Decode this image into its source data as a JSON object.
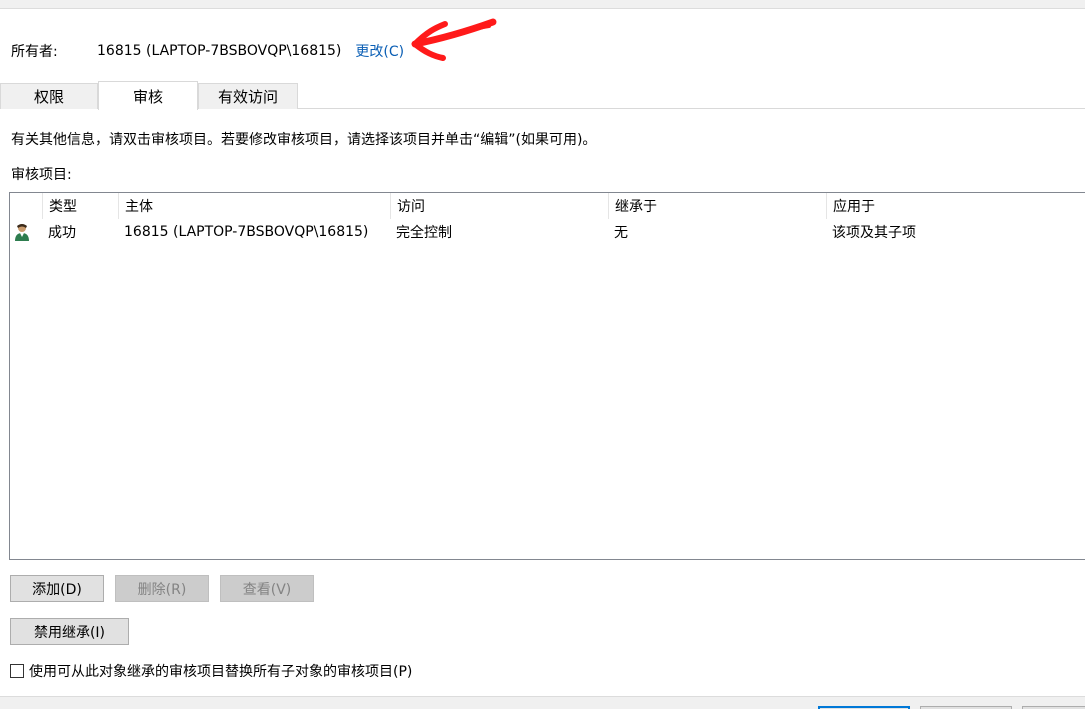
{
  "owner": {
    "label": "所有者:",
    "value": "16815 (LAPTOP-7BSBOVQP\\16815)",
    "change_link": "更改(C)"
  },
  "tabs": [
    {
      "label": "权限",
      "active": false
    },
    {
      "label": "审核",
      "active": true
    },
    {
      "label": "有效访问",
      "active": false
    }
  ],
  "info_text": "有关其他信息，请双击审核项目。若要修改审核项目，请选择该项目并单击“编辑”(如果可用)。",
  "entries_label": "审核项目:",
  "table": {
    "columns": [
      "类型",
      "主体",
      "访问",
      "继承于",
      "应用于"
    ],
    "rows": [
      {
        "icon": "user-icon",
        "type": "成功",
        "principal": "16815 (LAPTOP-7BSBOVQP\\16815)",
        "access": "完全控制",
        "inherited_from": "无",
        "applies_to": "该项及其子项"
      }
    ]
  },
  "buttons": {
    "add": "添加(D)",
    "remove": "删除(R)",
    "view": "查看(V)",
    "disable_inheritance": "禁用继承(I)"
  },
  "checkbox": {
    "label": "使用可从此对象继承的审核项目替换所有子对象的审核项目(P)",
    "checked": false
  },
  "colors": {
    "link": "#0b5fb5",
    "annotation_arrow": "#ff1a1a",
    "primary_border": "#0078d7"
  }
}
